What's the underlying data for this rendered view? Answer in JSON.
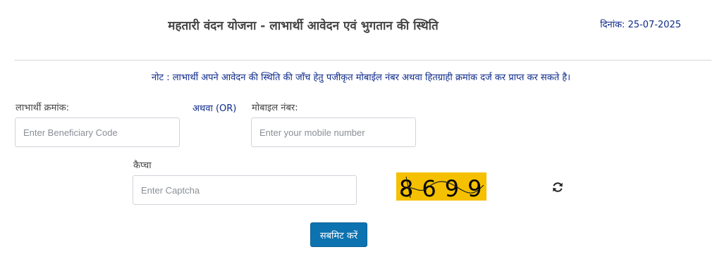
{
  "header": {
    "title": "महतारी वंदन योजना - लाभार्थी आवेदन एवं भुगतान की स्थिति",
    "date": "दिनांक: 25-07-2025"
  },
  "note": "नोट : लाभार्थी अपने आवेदन की स्थिति की जाँच हेतु पजीकृत मोबाईल नंबर अथवा हितग्राही क्रमांक दर्ज कर प्राप्त कर सकते है।",
  "form": {
    "beneficiary_label": "लाभार्थी क्रमांक:",
    "beneficiary_placeholder": "Enter Beneficiary Code",
    "beneficiary_value": "",
    "or_label": "अथवा (OR)",
    "mobile_label": "मोबाइल नंबर:",
    "mobile_placeholder": "Enter your mobile number",
    "mobile_value": "",
    "captcha_label": "कैप्चा",
    "captcha_placeholder": "Enter Captcha",
    "captcha_value": "",
    "captcha_text": "8699",
    "captcha_bg_color": "#f5c000",
    "refresh_icon": "refresh-icon",
    "submit_label": "सबमिट करें",
    "submit_color": "#0c72b0"
  }
}
